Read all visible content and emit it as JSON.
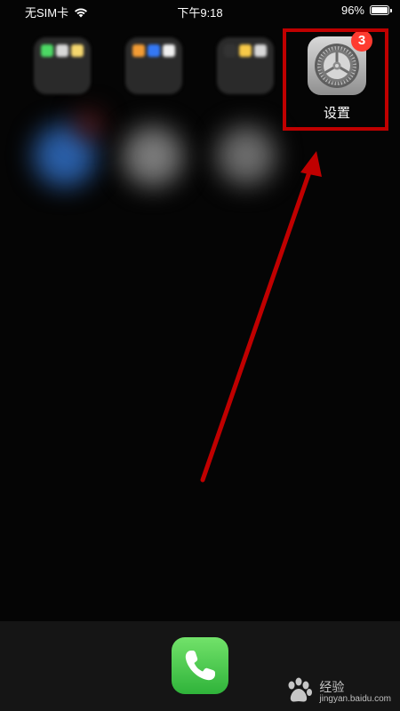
{
  "status_bar": {
    "carrier": "无SIM卡",
    "time": "下午9:18",
    "battery_percent": "96%",
    "battery_level": 0.96
  },
  "home": {
    "settings_app": {
      "label": "设置",
      "badge": "3",
      "icon": "gear-icon"
    },
    "folders": [
      {
        "colors": [
          "#4cd964",
          "#d8d8d8",
          "#f5d76e"
        ]
      },
      {
        "colors": [
          "#f39c34",
          "#3478f6",
          "#f0f0f0"
        ]
      },
      {
        "colors": [
          "#333333",
          "#f7c948",
          "#d8d8d8"
        ]
      }
    ]
  },
  "dock": {
    "phone_app": {
      "icon": "phone-icon"
    }
  },
  "watermark": {
    "brand": "Baidu",
    "text": "经验",
    "domain": "jingyan.baidu.com"
  },
  "annotation": {
    "color": "#c00000"
  }
}
